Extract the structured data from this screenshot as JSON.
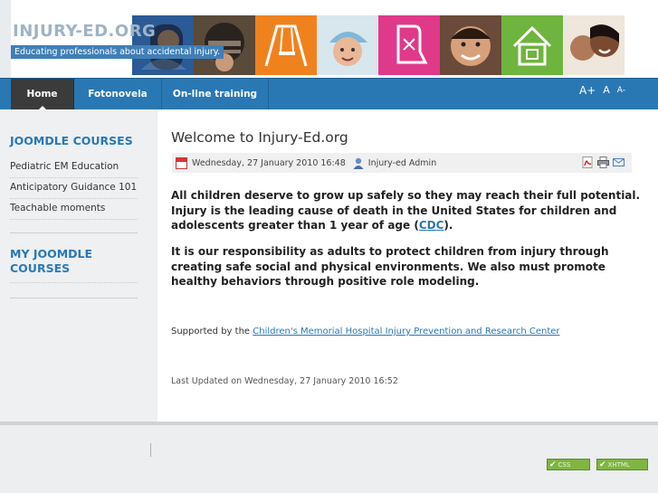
{
  "header": {
    "site_title": "INJURY-ED.ORG",
    "tagline": "Educating professionals about accidental injury."
  },
  "nav": {
    "items": [
      {
        "label": "Home",
        "active": true
      },
      {
        "label": "Fotonovela",
        "active": false
      },
      {
        "label": "On-line training",
        "active": false
      }
    ],
    "font_tools": [
      "A+",
      "A",
      "A-"
    ]
  },
  "sidebar": {
    "section1_title": "JOOMDLE COURSES",
    "courses": [
      "Pediatric EM Education",
      "Anticipatory Guidance 101",
      "Teachable moments"
    ],
    "section2_title_line1": "MY JOOMDLE",
    "section2_title_line2": "COURSES"
  },
  "article": {
    "title": "Welcome to Injury-Ed.org",
    "date": "Wednesday, 27 January 2010 16:48",
    "author": "Injury-ed Admin",
    "para1_text": "All children deserve to grow up safely so they may reach their full potential. Injury is the leading cause of death in the United States for children and adolescents greater than 1 year of age (",
    "para1_link": "CDC",
    "para1_end": ").",
    "para2": "It is our responsibility as adults to protect children from injury through creating safe social and physical environments. We also must promote healthy behaviors through positive role modeling.",
    "support_prefix": "Supported by the ",
    "support_link": "Children's Memorial Hospital Injury Prevention and Research Center",
    "last_updated": "Last Updated on Wednesday, 27 January 2010 16:52",
    "meta_icons": [
      "pdf-icon",
      "print-icon",
      "email-icon"
    ]
  },
  "footer": {
    "badges": [
      "CSS",
      "XHTML"
    ]
  },
  "colors": {
    "nav_blue": "#2a78b3",
    "nav_active": "#3b3b3b",
    "link_blue": "#2a78b3",
    "badge_green": "#7fb542"
  }
}
